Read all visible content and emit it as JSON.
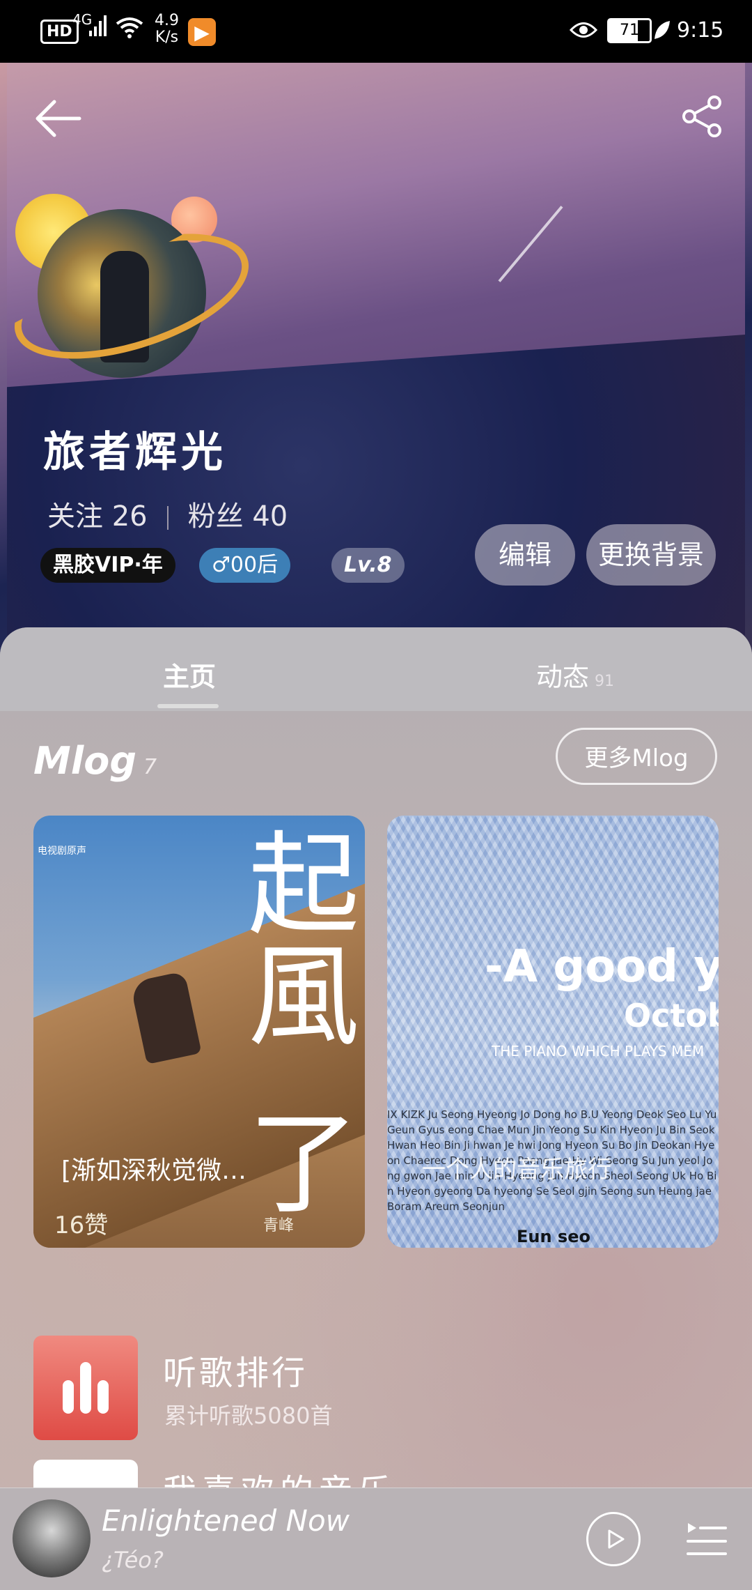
{
  "status_bar": {
    "hd": "HD",
    "network": "4G",
    "speed_value": "4.9",
    "speed_unit": "K/s",
    "battery": "71",
    "time": "9:15"
  },
  "profile": {
    "name": "旅者辉光",
    "following_label": "关注",
    "following_count": "26",
    "followers_label": "粉丝",
    "followers_count": "40",
    "vip_badge": "黑胶VIP·年",
    "gender_age_badge": "♂00后",
    "level_badge": "Lv.8",
    "edit_button": "编辑",
    "change_bg_button": "更换背景"
  },
  "tabs": [
    {
      "label": "主页",
      "active": true
    },
    {
      "label": "动态",
      "count": "91"
    }
  ],
  "mlog": {
    "title": "Mlog",
    "count": "7",
    "more_button": "更多Mlog",
    "cards": [
      {
        "big_text": [
          "起",
          "風",
          "了"
        ],
        "caption": "[渐如深秋觉微…",
        "likes": "16赞",
        "corner_text": "电视剧原声",
        "singer": "青峰"
      },
      {
        "headline": "-A good yea",
        "month": "Octob",
        "subline": "THE PIANO WHICH PLAYS MEM",
        "names": "IX KIZK Ju Seong Hyeong Jo Dong ho B.U Yeong Deok Seo Lu Yu Geun Gyus eong Chae Mun Jin Yeong Su Kin Hyeon Ju Bin Seok Hwan Heo Bin Ji hwan Je hwi Jong Hyeon Su Bo Jin Deokan Hyeon Chaerec Dong Hyeon Paeng Jae Hy Wi Seong Su Jun yeol Jong gwon Jae min U jin Hyeong jun Hyeon Sheol Seong Uk Ho Bin Hyeon gyeong Da hyeong Se Seol gjin Seong sun Heung jae Boram Areum Seonjun",
        "overlay": "一个人的音乐旅行",
        "bottom_text": "Eun  seo"
      }
    ]
  },
  "rows": [
    {
      "title": "听歌排行",
      "subtitle": "累计听歌5080首"
    },
    {
      "title": "我喜欢的音乐"
    }
  ],
  "player": {
    "song": "Enlightened Now",
    "artist": "¿Téo?"
  },
  "colors": {
    "vip_badge_bg": "#111111",
    "gender_badge_bg": "#3d7fb6",
    "rank_icon": "#e0524b"
  }
}
